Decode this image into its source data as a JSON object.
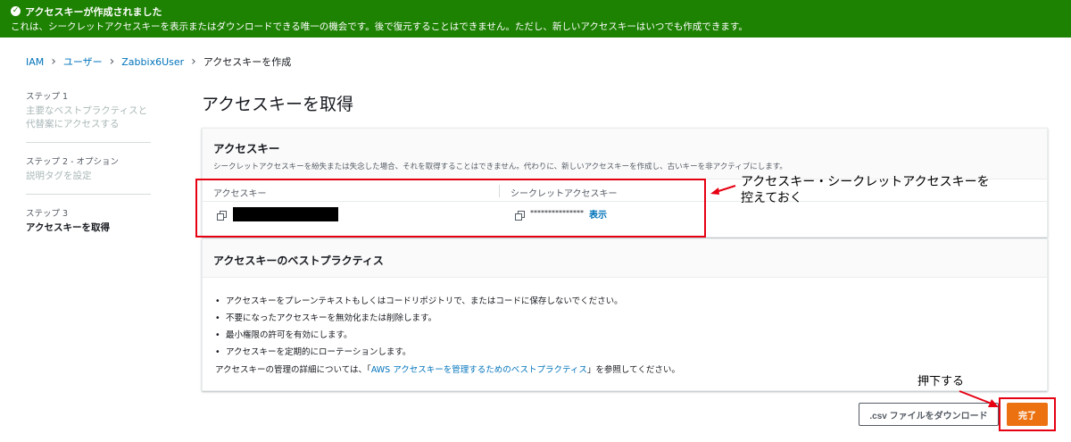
{
  "banner": {
    "title": "アクセスキーが作成されました",
    "message": "これは、シークレットアクセスキーを表示またはダウンロードできる唯一の機会です。後で復元することはできません。ただし、新しいアクセスキーはいつでも作成できます。",
    "color": "#1d8102"
  },
  "breadcrumb": {
    "items": [
      "IAM",
      "ユーザー",
      "Zabbix6User"
    ],
    "current": "アクセスキーを作成"
  },
  "steps": [
    {
      "num": "ステップ 1",
      "title": "主要なベストプラクティスと代替案にアクセスする"
    },
    {
      "num": "ステップ 2 - オプション",
      "title": "説明タグを設定"
    },
    {
      "num": "ステップ 3",
      "title": "アクセスキーを取得"
    }
  ],
  "page_title": "アクセスキーを取得",
  "access_key_panel": {
    "title": "アクセスキー",
    "description": "シークレットアクセスキーを紛失または失念した場合、それを取得することはできません。代わりに、新しいアクセスキーを作成し、古いキーを非アクティブにします。",
    "col_access_key": "アクセスキー",
    "col_secret_key": "シークレットアクセスキー",
    "secret_masked": "***************",
    "show_label": "表示"
  },
  "best_practices": {
    "title": "アクセスキーのベストプラクティス",
    "items": [
      "アクセスキーをプレーンテキストもしくはコードリポジトリで、またはコードに保存しないでください。",
      "不要になったアクセスキーを無効化または削除します。",
      "最小権限の許可を有効にします。",
      "アクセスキーを定期的にローテーションします。"
    ],
    "more_prefix": "アクセスキーの管理の詳細については、「",
    "more_link": "AWS アクセスキーを管理するためのベストプラクティス",
    "more_suffix": "」を参照してください。"
  },
  "buttons": {
    "download": ".csv ファイルをダウンロード",
    "done": "完了",
    "done_color": "#ec7211"
  },
  "annotations": {
    "note1_line1": "アクセスキー・シークレットアクセスキーを",
    "note1_line2": "控えておく",
    "note2": "押下する",
    "color": "#e60012"
  }
}
